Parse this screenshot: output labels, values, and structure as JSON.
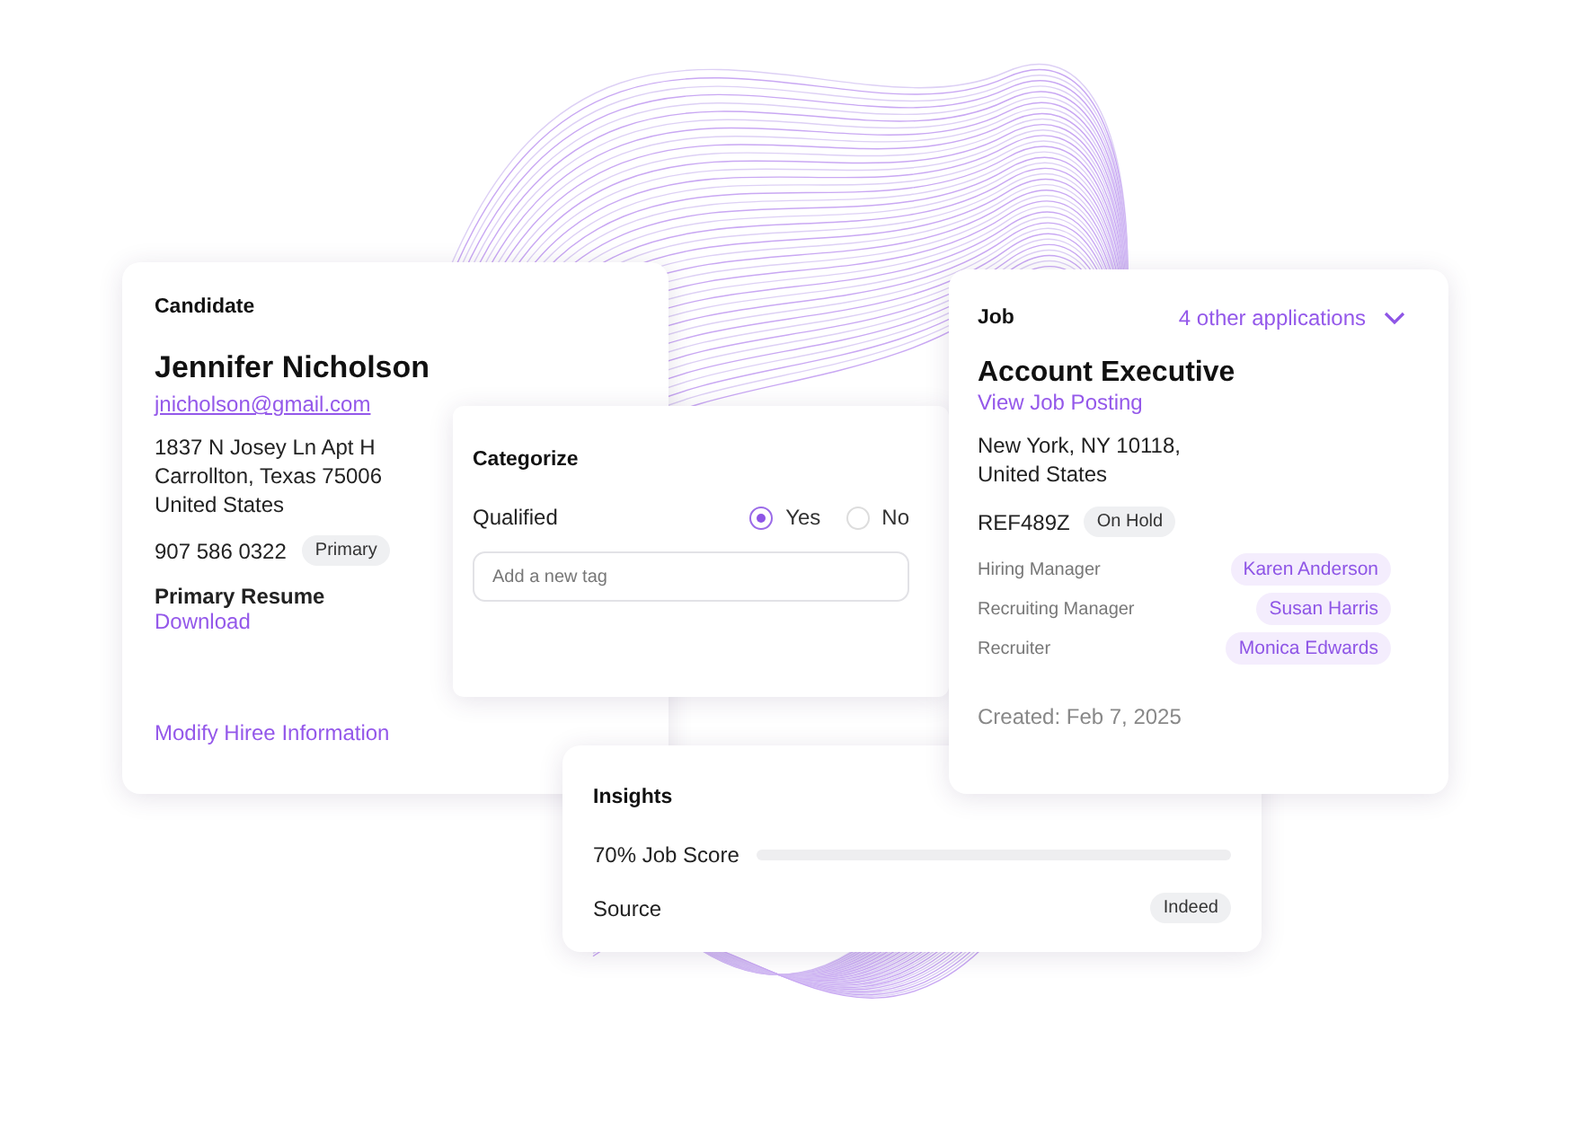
{
  "candidate": {
    "heading": "Candidate",
    "name": "Jennifer Nicholson",
    "email": "jnicholson@gmail.com",
    "address": [
      "1837 N Josey Ln Apt H",
      "Carrollton, Texas 75006",
      "United States"
    ],
    "phone": "907 586 0322",
    "phone_tag": "Primary",
    "resume_heading": "Primary Resume",
    "resume_link": "Download",
    "modify_link": "Modify Hiree Information"
  },
  "categorize": {
    "heading": "Categorize",
    "qualified": {
      "label": "Qualified",
      "options": [
        {
          "label": "Yes",
          "selected": true
        },
        {
          "label": "No",
          "selected": false
        }
      ]
    },
    "tag_field": {
      "placeholder": "Add a new tag"
    }
  },
  "job": {
    "heading": "Job",
    "other_applications": "4 other applications",
    "title": "Account Executive",
    "posting_link": "View Job Posting",
    "location": [
      "New York, NY 10118,",
      "United States"
    ],
    "reference": "REF489Z",
    "status": "On Hold",
    "team": [
      {
        "role": "Hiring Manager",
        "person": "Karen Anderson"
      },
      {
        "role": "Recruiting Manager",
        "person": "Susan Harris"
      },
      {
        "role": "Recruiter",
        "person": "Monica Edwards"
      }
    ],
    "created": "Created: Feb 7, 2025"
  },
  "insights": {
    "heading": "Insights",
    "score": {
      "label": "70% Job Score"
    },
    "source": {
      "label": "Source",
      "value": "Indeed"
    }
  }
}
